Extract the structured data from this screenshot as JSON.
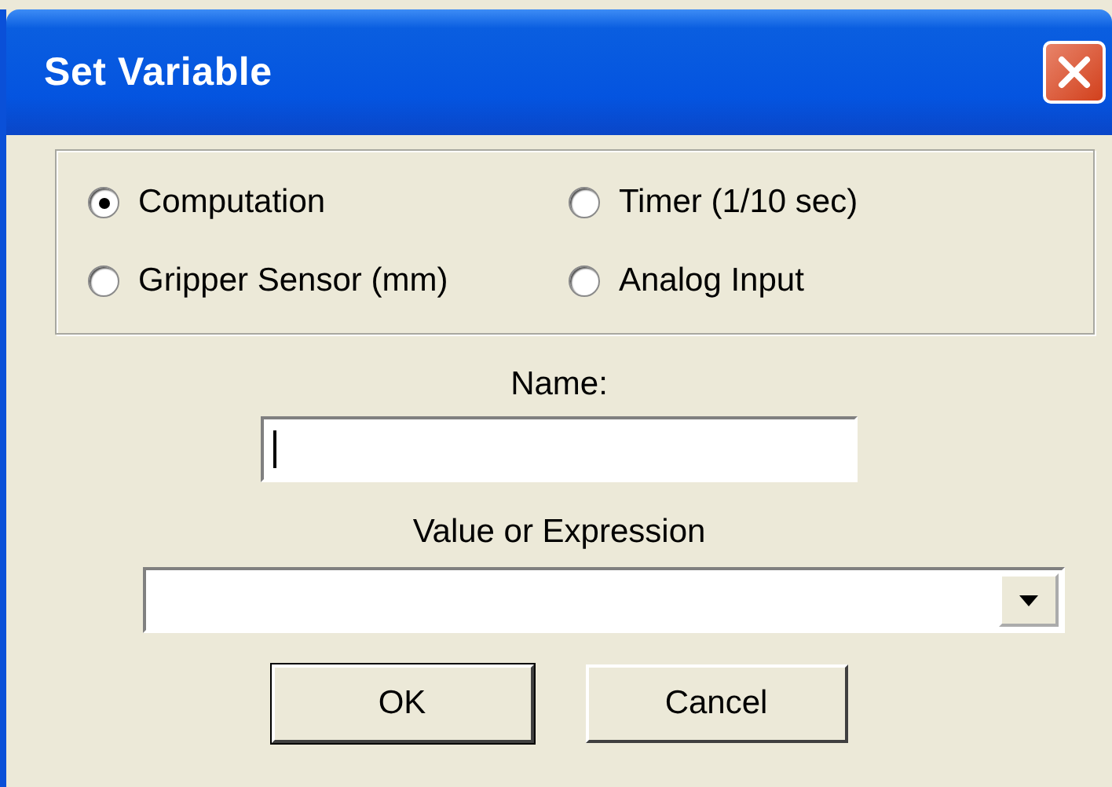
{
  "window": {
    "title": "Set Variable"
  },
  "variable_types": [
    {
      "label": "Computation",
      "selected": true
    },
    {
      "label": "Timer (1/10 sec)",
      "selected": false
    },
    {
      "label": "Gripper Sensor (mm)",
      "selected": false
    },
    {
      "label": "Analog Input",
      "selected": false
    }
  ],
  "name_field": {
    "label": "Name:",
    "focused": true
  },
  "expression_field": {
    "label": "Value or Expression"
  },
  "buttons": [
    {
      "label": "OK",
      "default": true
    },
    {
      "label": "Cancel",
      "default": false
    }
  ]
}
